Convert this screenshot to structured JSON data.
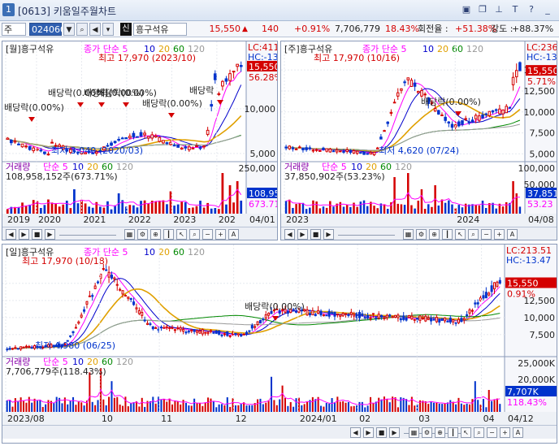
{
  "window": {
    "number": "1",
    "title": "[0613] 키움일주월차트"
  },
  "toolbar": {
    "mode": "주",
    "code": "024060",
    "badge": "신",
    "stock_name": "흥구석유",
    "price": "15,550",
    "up_glyph": "▲",
    "change": "140",
    "change_rate": "+0.91%",
    "volume": "7,706,779",
    "volume_rate": "18.43%",
    "turnover_label": "회전율 :",
    "turnover_value": "+51.38%",
    "strength_label": "강도 :",
    "strength_value": "+88.37%"
  },
  "colors": {
    "up": "#d40000",
    "down": "#0033cc",
    "ma5": "#ff00ff",
    "ma10": "#0000cc",
    "ma20": "#e0a000",
    "ma60": "#008800",
    "ma120": "#999999"
  },
  "panes": {
    "monthly": {
      "legend": "[월]흥구석유",
      "ma_label": "종가 단순 5",
      "ma_periods": [
        "10",
        "20",
        "60",
        "120"
      ],
      "high_label": "최고 17,970 (2023/10)",
      "low_label": "최저 3,040 (2020/03)",
      "lc": "LC:411.5",
      "hc": "HC:-13.4",
      "price_tag": "15,550",
      "pct_tag": "56.28%",
      "y_ticks": [
        "10,000",
        "5,000"
      ],
      "dividends": [
        "배당락(0.00%)",
        "배당락(0.00%)",
        "배당락(0.00%)",
        "배당락(0.00%)",
        "배당락(0.00%)",
        "배당락"
      ],
      "vol_legend": "거래량",
      "vol_ma": [
        "단순 5",
        "10",
        "20",
        "60",
        "120"
      ],
      "vol_value": "108,958,152주(673.71%)",
      "vol_ticks": [
        "250,000"
      ],
      "vol_tag": "108,95",
      "vol_pct": "673.71",
      "x_ticks": [
        "2019",
        "2020",
        "2021",
        "2022",
        "2023",
        "202"
      ],
      "last_date": "04/01"
    },
    "weekly": {
      "legend": "[주]흥구석유",
      "ma_label": "종가 단순 5",
      "ma_periods": [
        "10",
        "20",
        "60",
        "120"
      ],
      "high_label": "최고 17,970 (10/16)",
      "low_label": "최저 4,620 (07/24)",
      "lc": "LC:236.5",
      "hc": "HC:-13.4",
      "price_tag": "15,550",
      "pct_tag": "5.71%",
      "y_ticks": [
        "15,000",
        "12,500",
        "10,000",
        "7,500",
        "5,000"
      ],
      "dividend": "배당락(0.00%)",
      "vol_legend": "거래량",
      "vol_ma": [
        "단순 5",
        "10",
        "20",
        "60",
        "120"
      ],
      "vol_value": "37,850,902주(53.23%)",
      "vol_ticks": [
        "100,000",
        "50,000"
      ],
      "vol_tag": "37,851",
      "vol_pct": "53.23",
      "x_ticks": [
        "2023",
        "2024"
      ],
      "last_date": "04/08"
    },
    "daily": {
      "legend": "[일]흥구석유",
      "ma_label": "종가 단순 5",
      "ma_periods": [
        "10",
        "20",
        "60",
        "120"
      ],
      "high_label": "최고 17,970 (10/18)",
      "low_label": "최저 4,980 (06/25)",
      "lc": "LC:213.51",
      "hc": "HC:-13.47",
      "price_tag": "15,550",
      "pct_tag": "0.91%",
      "y_ticks": [
        "15,000",
        "12,500",
        "10,000",
        "7,500"
      ],
      "dividend": "배당락(0.00%)",
      "vol_legend": "거래량",
      "vol_ma": [
        "단순 5",
        "10",
        "20",
        "60",
        "120"
      ],
      "vol_value": "7,706,779주(118.43%)",
      "vol_ticks": [
        "25,000K",
        "20,000K"
      ],
      "vol_tag": "7,707K",
      "vol_pct": "118.43%",
      "x_ticks": [
        "2023/08",
        "10",
        "11",
        "12",
        "2024/01",
        "02",
        "03",
        "04"
      ],
      "last_date": "04/12"
    }
  },
  "nav_icons": [
    "left-arrow-icon",
    "play-icon",
    "stop-icon",
    "right-arrow-icon"
  ]
}
